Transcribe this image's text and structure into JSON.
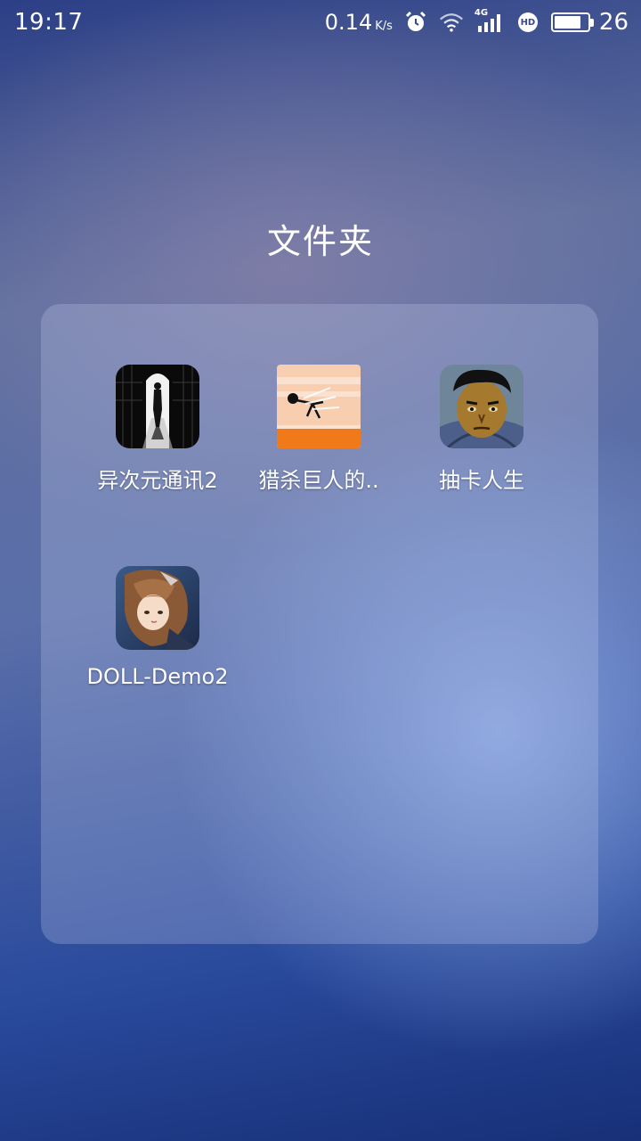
{
  "status_bar": {
    "time": "19:17",
    "net_speed": "0.14",
    "net_unit": "K/s",
    "signal_label": "4G",
    "hd_label": "HD",
    "battery_level": "26"
  },
  "folder": {
    "title": "文件夹",
    "apps": [
      {
        "label": "异次元通讯2",
        "icon": "dark-doorway-silhouette-icon"
      },
      {
        "label": "猎杀巨人的..",
        "icon": "stickman-running-icon"
      },
      {
        "label": "抽卡人生",
        "icon": "man-face-icon"
      },
      {
        "label": "DOLL-Demo2",
        "icon": "anime-girl-icon"
      }
    ]
  },
  "colors": {
    "accent_orange": "#f07a1a",
    "peach": "#f7cfb0"
  }
}
